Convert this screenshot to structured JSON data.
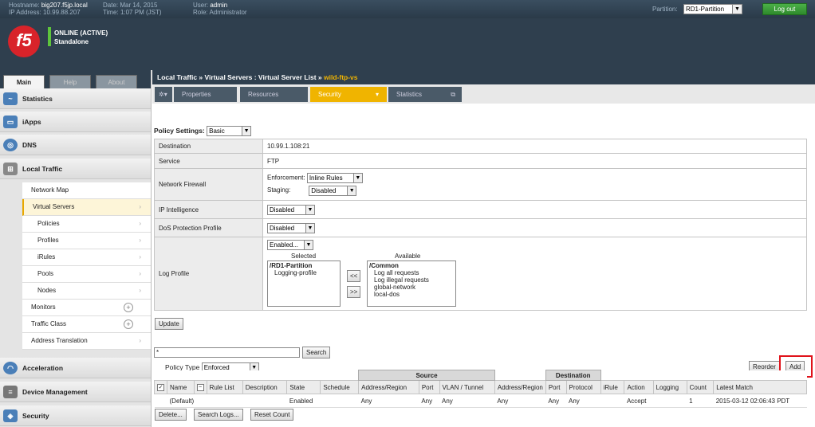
{
  "header": {
    "hostname_label": "Hostname:",
    "hostname": "big207.f5jp.local",
    "ip_label": "IP Address:",
    "ip": "10.99.88.207",
    "date_label": "Date:",
    "date": "Mar 14, 2015",
    "time_label": "Time:",
    "time": "1:07 PM (JST)",
    "user_label": "User:",
    "user": "admin",
    "role_label": "Role:",
    "role": "Administrator",
    "partition_label": "Partition:",
    "partition": "RD1-Partition",
    "logout": "Log out",
    "status1": "ONLINE (ACTIVE)",
    "status2": "Standalone",
    "logo": "f5"
  },
  "sidebar": {
    "tabs": [
      "Main",
      "Help",
      "About"
    ],
    "sections": {
      "statistics": "Statistics",
      "iapps": "iApps",
      "dns": "DNS",
      "local_traffic": "Local Traffic",
      "acceleration": "Acceleration",
      "device_management": "Device Management",
      "security": "Security"
    },
    "items": [
      "Network Map",
      "Virtual Servers",
      "Policies",
      "Profiles",
      "iRules",
      "Pools",
      "Nodes",
      "Monitors",
      "Traffic Class",
      "Address Translation"
    ]
  },
  "breadcrumb": {
    "path": "Local Traffic  »  Virtual Servers : Virtual Server List  »",
    "current": "wild-ftp-vs"
  },
  "content_tabs": [
    "Properties",
    "Resources",
    "Security",
    "Statistics"
  ],
  "policy": {
    "label": "Policy Settings:",
    "mode": "Basic",
    "rows": {
      "destination_label": "Destination",
      "destination": "10.99.1.108:21",
      "service_label": "Service",
      "service": "FTP",
      "firewall_label": "Network Firewall",
      "enforcement_label": "Enforcement:",
      "enforcement": "Inline Rules",
      "staging_label": "Staging:",
      "staging": "Disabled",
      "ip_intel_label": "IP Intelligence",
      "ip_intel": "Disabled",
      "dos_label": "DoS Protection Profile",
      "dos": "Disabled",
      "log_label": "Log Profile",
      "log": "Enabled...",
      "selected_label": "Selected",
      "available_label": "Available",
      "selected_items": [
        "/RD1-Partition",
        "Logging-profile"
      ],
      "available_items": [
        "/Common",
        "Log all requests",
        "Log illegal requests",
        "global-network",
        "local-dos"
      ],
      "move_left": "<<",
      "move_right": ">>"
    },
    "update": "Update"
  },
  "rules": {
    "search_value": "*",
    "search_button": "Search",
    "policy_type_label": "Policy Type",
    "policy_type": "Enforced",
    "reorder": "Reorder",
    "add": "Add",
    "group_source": "Source",
    "group_destination": "Destination",
    "columns": [
      "Name",
      "Rule List",
      "Description",
      "State",
      "Schedule",
      "Address/Region",
      "Port",
      "VLAN / Tunnel",
      "Address/Region",
      "Port",
      "Protocol",
      "iRule",
      "Action",
      "Logging",
      "Count",
      "Latest Match"
    ],
    "rows": [
      {
        "name": "(Default)",
        "rule_list": "",
        "description": "",
        "state": "Enabled",
        "schedule": "",
        "src_addr": "Any",
        "src_port": "Any",
        "vlan": "Any",
        "dst_addr": "Any",
        "dst_port": "Any",
        "protocol": "Any",
        "irule": "",
        "action": "Accept",
        "logging": "",
        "count": "1",
        "latest": "2015-03-12 02:06:43 PDT"
      }
    ],
    "buttons": [
      "Delete...",
      "Search Logs...",
      "Reset Count"
    ]
  }
}
